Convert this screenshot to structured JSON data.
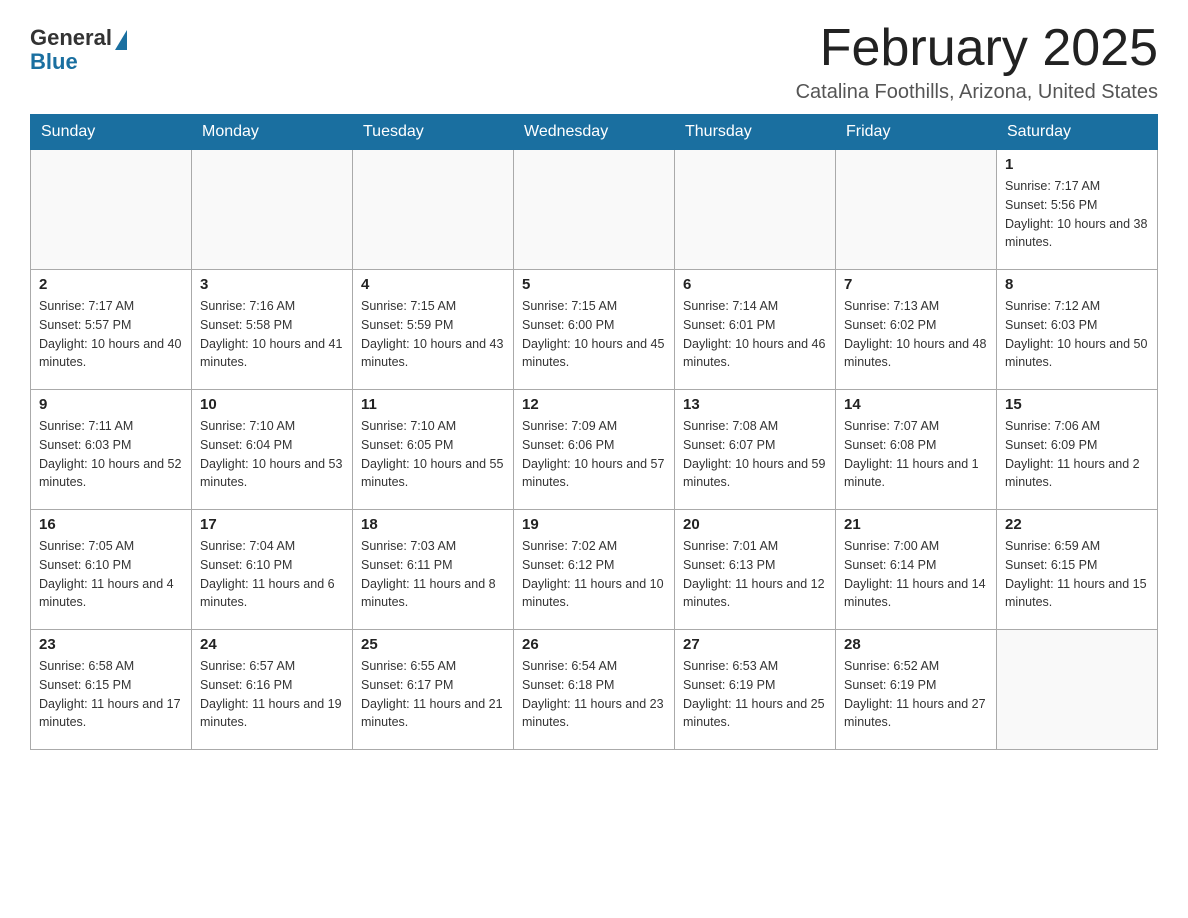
{
  "logo": {
    "general": "General",
    "blue": "Blue"
  },
  "header": {
    "month_year": "February 2025",
    "location": "Catalina Foothills, Arizona, United States"
  },
  "days_of_week": [
    "Sunday",
    "Monday",
    "Tuesday",
    "Wednesday",
    "Thursday",
    "Friday",
    "Saturday"
  ],
  "weeks": [
    [
      {
        "day": "",
        "info": ""
      },
      {
        "day": "",
        "info": ""
      },
      {
        "day": "",
        "info": ""
      },
      {
        "day": "",
        "info": ""
      },
      {
        "day": "",
        "info": ""
      },
      {
        "day": "",
        "info": ""
      },
      {
        "day": "1",
        "info": "Sunrise: 7:17 AM\nSunset: 5:56 PM\nDaylight: 10 hours and 38 minutes."
      }
    ],
    [
      {
        "day": "2",
        "info": "Sunrise: 7:17 AM\nSunset: 5:57 PM\nDaylight: 10 hours and 40 minutes."
      },
      {
        "day": "3",
        "info": "Sunrise: 7:16 AM\nSunset: 5:58 PM\nDaylight: 10 hours and 41 minutes."
      },
      {
        "day": "4",
        "info": "Sunrise: 7:15 AM\nSunset: 5:59 PM\nDaylight: 10 hours and 43 minutes."
      },
      {
        "day": "5",
        "info": "Sunrise: 7:15 AM\nSunset: 6:00 PM\nDaylight: 10 hours and 45 minutes."
      },
      {
        "day": "6",
        "info": "Sunrise: 7:14 AM\nSunset: 6:01 PM\nDaylight: 10 hours and 46 minutes."
      },
      {
        "day": "7",
        "info": "Sunrise: 7:13 AM\nSunset: 6:02 PM\nDaylight: 10 hours and 48 minutes."
      },
      {
        "day": "8",
        "info": "Sunrise: 7:12 AM\nSunset: 6:03 PM\nDaylight: 10 hours and 50 minutes."
      }
    ],
    [
      {
        "day": "9",
        "info": "Sunrise: 7:11 AM\nSunset: 6:03 PM\nDaylight: 10 hours and 52 minutes."
      },
      {
        "day": "10",
        "info": "Sunrise: 7:10 AM\nSunset: 6:04 PM\nDaylight: 10 hours and 53 minutes."
      },
      {
        "day": "11",
        "info": "Sunrise: 7:10 AM\nSunset: 6:05 PM\nDaylight: 10 hours and 55 minutes."
      },
      {
        "day": "12",
        "info": "Sunrise: 7:09 AM\nSunset: 6:06 PM\nDaylight: 10 hours and 57 minutes."
      },
      {
        "day": "13",
        "info": "Sunrise: 7:08 AM\nSunset: 6:07 PM\nDaylight: 10 hours and 59 minutes."
      },
      {
        "day": "14",
        "info": "Sunrise: 7:07 AM\nSunset: 6:08 PM\nDaylight: 11 hours and 1 minute."
      },
      {
        "day": "15",
        "info": "Sunrise: 7:06 AM\nSunset: 6:09 PM\nDaylight: 11 hours and 2 minutes."
      }
    ],
    [
      {
        "day": "16",
        "info": "Sunrise: 7:05 AM\nSunset: 6:10 PM\nDaylight: 11 hours and 4 minutes."
      },
      {
        "day": "17",
        "info": "Sunrise: 7:04 AM\nSunset: 6:10 PM\nDaylight: 11 hours and 6 minutes."
      },
      {
        "day": "18",
        "info": "Sunrise: 7:03 AM\nSunset: 6:11 PM\nDaylight: 11 hours and 8 minutes."
      },
      {
        "day": "19",
        "info": "Sunrise: 7:02 AM\nSunset: 6:12 PM\nDaylight: 11 hours and 10 minutes."
      },
      {
        "day": "20",
        "info": "Sunrise: 7:01 AM\nSunset: 6:13 PM\nDaylight: 11 hours and 12 minutes."
      },
      {
        "day": "21",
        "info": "Sunrise: 7:00 AM\nSunset: 6:14 PM\nDaylight: 11 hours and 14 minutes."
      },
      {
        "day": "22",
        "info": "Sunrise: 6:59 AM\nSunset: 6:15 PM\nDaylight: 11 hours and 15 minutes."
      }
    ],
    [
      {
        "day": "23",
        "info": "Sunrise: 6:58 AM\nSunset: 6:15 PM\nDaylight: 11 hours and 17 minutes."
      },
      {
        "day": "24",
        "info": "Sunrise: 6:57 AM\nSunset: 6:16 PM\nDaylight: 11 hours and 19 minutes."
      },
      {
        "day": "25",
        "info": "Sunrise: 6:55 AM\nSunset: 6:17 PM\nDaylight: 11 hours and 21 minutes."
      },
      {
        "day": "26",
        "info": "Sunrise: 6:54 AM\nSunset: 6:18 PM\nDaylight: 11 hours and 23 minutes."
      },
      {
        "day": "27",
        "info": "Sunrise: 6:53 AM\nSunset: 6:19 PM\nDaylight: 11 hours and 25 minutes."
      },
      {
        "day": "28",
        "info": "Sunrise: 6:52 AM\nSunset: 6:19 PM\nDaylight: 11 hours and 27 minutes."
      },
      {
        "day": "",
        "info": ""
      }
    ]
  ]
}
